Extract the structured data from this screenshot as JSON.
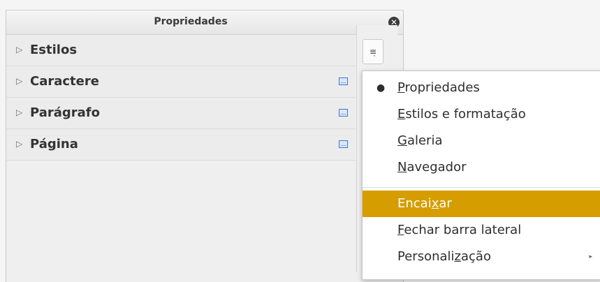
{
  "sidebar": {
    "title": "Propriedades",
    "close_icon": "close-icon",
    "decks": [
      {
        "label": "Estilos",
        "has_more": false
      },
      {
        "label": "Caractere",
        "has_more": true
      },
      {
        "label": "Parágrafo",
        "has_more": true
      },
      {
        "label": "Página",
        "has_more": true
      }
    ],
    "menu_button_icon": "menu-icon"
  },
  "menu": {
    "items": [
      {
        "pre": "",
        "mn": "P",
        "post": "ropriedades",
        "checked": true
      },
      {
        "pre": "",
        "mn": "E",
        "post": "stilos e formatação"
      },
      {
        "pre": "",
        "mn": "G",
        "post": "aleria"
      },
      {
        "pre": "",
        "mn": "N",
        "post": "avegador"
      },
      {
        "pre": "Encai",
        "mn": "x",
        "post": "ar",
        "highlighted": true
      },
      {
        "pre": "",
        "mn": "F",
        "post": "echar barra lateral"
      },
      {
        "pre": "Personali",
        "mn": "z",
        "post": "ação",
        "submenu": true
      }
    ]
  },
  "colors": {
    "highlight": "#d69d00",
    "accent_blue": "#3b78c4"
  }
}
